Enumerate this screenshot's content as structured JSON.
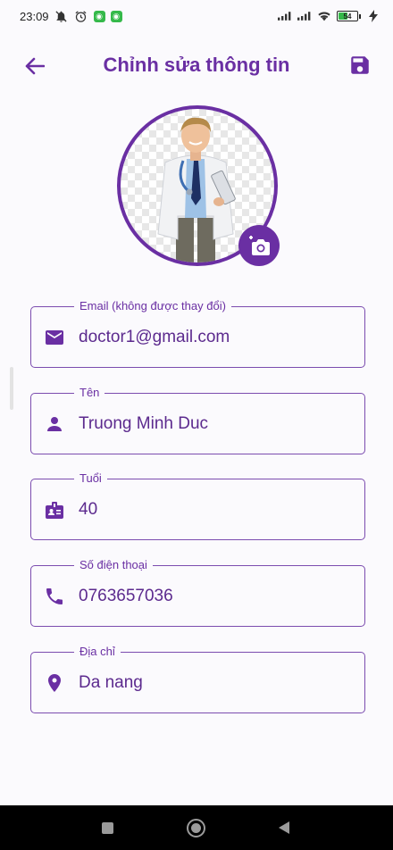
{
  "status_bar": {
    "time": "23:09",
    "battery_level": "54",
    "battery_percent": 54
  },
  "header": {
    "title": "Chỉnh sửa thông tin",
    "back_icon": "arrow-back-icon",
    "save_icon": "save-icon"
  },
  "avatar": {
    "image": "doctor-avatar",
    "camera_icon": "add-photo-icon"
  },
  "form": {
    "fields": [
      {
        "label": "Email (không được thay đổi)",
        "value": "doctor1@gmail.com",
        "icon": "email-icon"
      },
      {
        "label": "Tên",
        "value": "Truong Minh Duc",
        "icon": "person-icon"
      },
      {
        "label": "Tuổi",
        "value": "40",
        "icon": "badge-icon"
      },
      {
        "label": "Số điện thoại",
        "value": "0763657036",
        "icon": "phone-icon"
      },
      {
        "label": "Địa chỉ",
        "value": "Da nang",
        "icon": "location-pin-icon"
      }
    ]
  },
  "colors": {
    "accent": "#6a2fa3",
    "background": "#fbfafd",
    "nav_bar": "#000000"
  }
}
